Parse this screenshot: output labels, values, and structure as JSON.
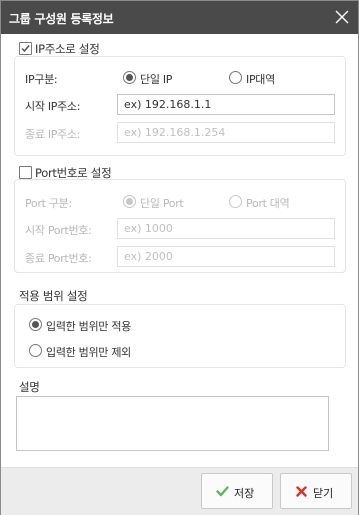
{
  "dialog": {
    "title": "그룹 구성원 등록정보"
  },
  "ip_section": {
    "enabled": true,
    "checkbox_label": "IP주소로 설정",
    "type_label": "IP구분:",
    "options": [
      "단일 IP",
      "IP대역"
    ],
    "selected": "단일 IP",
    "start_label": "시작 IP주소:",
    "start_value": "ex) 192.168.1.1",
    "end_label": "종료 IP주소:",
    "end_placeholder": "ex) 192.168.1.254"
  },
  "port_section": {
    "enabled": false,
    "checkbox_label": "Port번호로 설정",
    "type_label": "Port 구분:",
    "options": [
      "단일 Port",
      "Port 대역"
    ],
    "selected": "단일 Port",
    "start_label": "시작 Port번호:",
    "start_placeholder": "ex) 1000",
    "end_label": "종료 Port번호:",
    "end_placeholder": "ex) 2000"
  },
  "scope_section": {
    "title": "적용 범위 설정",
    "options": [
      "입력한 범위만 적용",
      "입력한 범위만 제외"
    ],
    "selected": "입력한 범위만 적용"
  },
  "description": {
    "label": "설명",
    "value": ""
  },
  "footer": {
    "save_label": "저장",
    "close_label": "닫기"
  },
  "colors": {
    "titlebar": "#4a4a4a",
    "save_icon": "#5cb85c",
    "close_icon": "#d9312c"
  }
}
